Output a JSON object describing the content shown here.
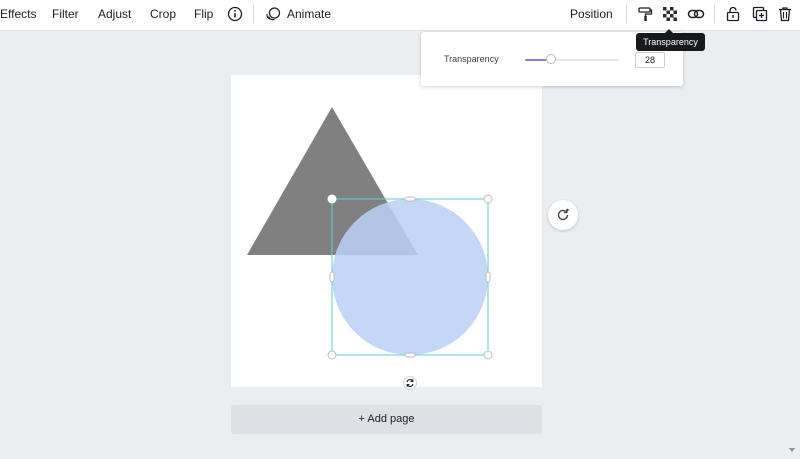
{
  "toolbar": {
    "effects": "Effects",
    "filter": "Filter",
    "adjust": "Adjust",
    "crop": "Crop",
    "flip": "Flip",
    "info_icon": "info-circle-icon",
    "animate": "Animate",
    "position": "Position",
    "icons": [
      "paint-roller-icon",
      "transparency-checker-icon",
      "link-icon",
      "unlock-icon",
      "duplicate-icon",
      "trash-icon"
    ]
  },
  "transparency_panel": {
    "label": "Transparency",
    "value": "28",
    "slider_fraction": 0.28,
    "accent": "#9b7bd6"
  },
  "tooltip": {
    "text": "Transparency"
  },
  "canvas": {
    "triangle_color": "#808080",
    "circle_color": "#c2d4f5",
    "selection_color": "#5fcfd2"
  },
  "add_page_label": "+ Add page"
}
